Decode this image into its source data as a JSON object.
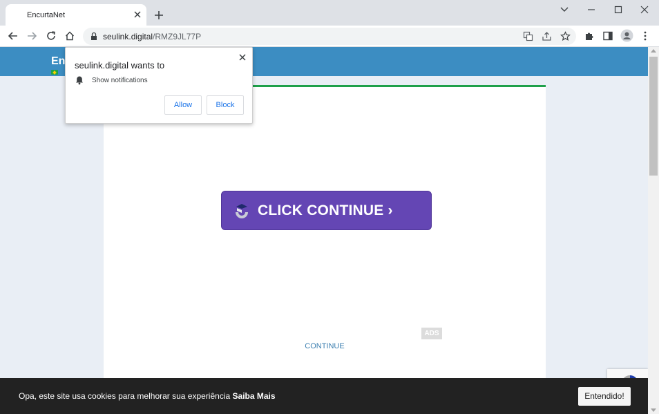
{
  "browser": {
    "tab_title": "EncurtaNet",
    "url_domain": "seulink.digital",
    "url_path": "/RMZ9JL77P"
  },
  "site": {
    "logo_text": "En"
  },
  "card": {
    "cta_label": "CLICK CONTINUE ›",
    "ads_label": "ADS",
    "continue_label": "CONTINUE"
  },
  "cookie": {
    "text": "Opa, este site usa cookies para melhorar sua experiência",
    "link": "Saiba Mais",
    "button": "Entendido!"
  },
  "permission": {
    "title": "seulink.digital wants to",
    "item": "Show notifications",
    "allow": "Allow",
    "block": "Block"
  },
  "colors": {
    "header": "#3c8dc2",
    "cta": "#6446b4",
    "card_border": "#1fa04a",
    "cookie_bar": "#222222",
    "link": "#1a73e8"
  },
  "icons": [
    "close-icon",
    "plus-icon",
    "chevron-down-icon",
    "minimize-icon",
    "maximize-icon",
    "back-icon",
    "forward-icon",
    "reload-icon",
    "home-icon",
    "lock-icon",
    "translate-icon",
    "share-icon",
    "star-icon",
    "extensions-icon",
    "sidepanel-icon",
    "profile-icon",
    "menu-icon",
    "bell-icon",
    "recaptcha-icon"
  ]
}
